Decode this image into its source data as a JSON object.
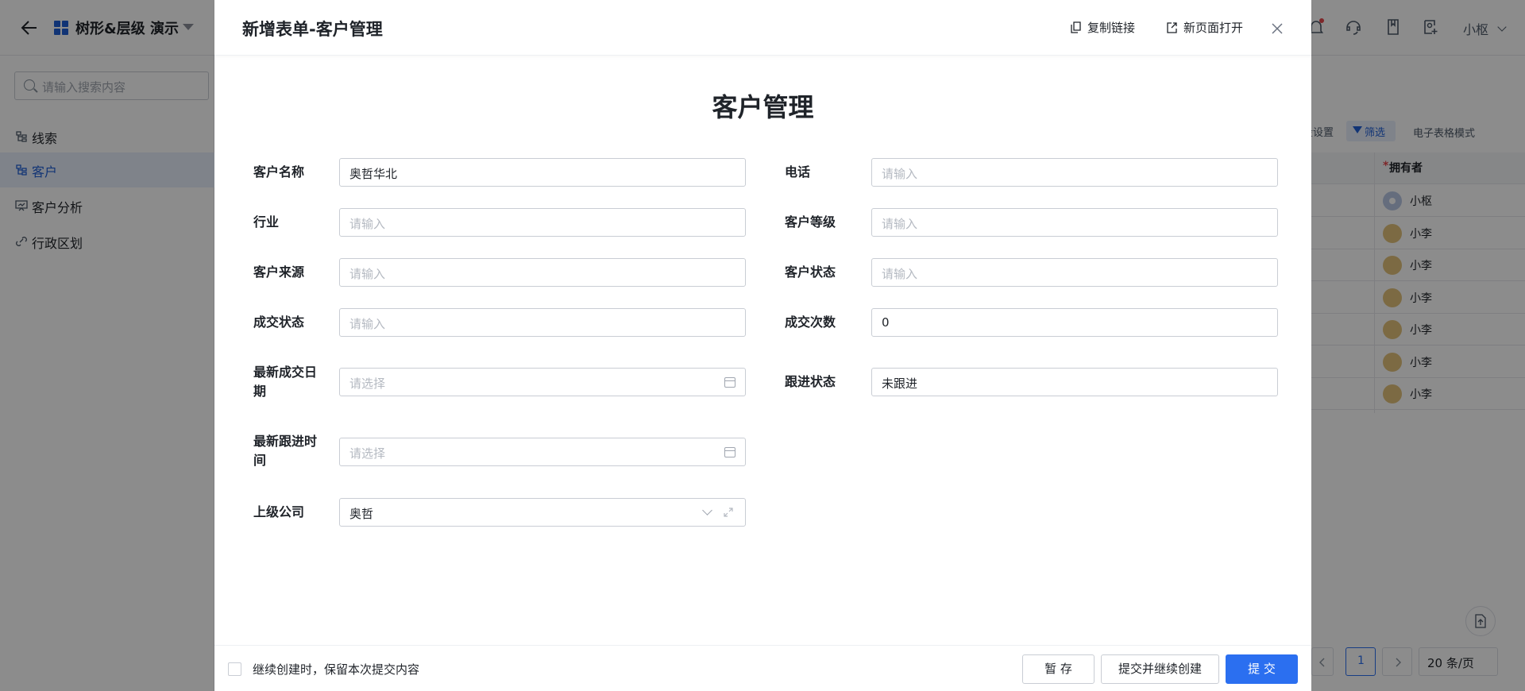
{
  "app": {
    "title": "树形&层级 演示",
    "user_name": "小枢"
  },
  "sidebar": {
    "search_placeholder": "请输入搜索内容",
    "items": [
      {
        "label": "线索"
      },
      {
        "label": "客户"
      },
      {
        "label": "客户分析"
      },
      {
        "label": "行政区划"
      }
    ]
  },
  "background_table": {
    "toolbar": {
      "field_settings": "段设置",
      "filter": "筛选",
      "mode": "电子表格模式"
    },
    "owner_header": "拥有者",
    "rows": [
      "小枢",
      "小李",
      "小李",
      "小李",
      "小李",
      "小李",
      "小李"
    ],
    "pager": {
      "current_page": "1",
      "page_size": "20 条/页"
    }
  },
  "drawer": {
    "title": "新增表单-客户管理",
    "copy_link": "复制链接",
    "open_new_page": "新页面打开"
  },
  "form": {
    "title": "客户管理",
    "fields": {
      "customer_name": {
        "label": "客户名称",
        "value": "奥哲华北"
      },
      "phone": {
        "label": "电话",
        "placeholder": "请输入"
      },
      "industry": {
        "label": "行业",
        "placeholder": "请输入"
      },
      "customer_level": {
        "label": "客户等级",
        "placeholder": "请输入"
      },
      "customer_source": {
        "label": "客户来源",
        "placeholder": "请输入"
      },
      "customer_status": {
        "label": "客户状态",
        "placeholder": "请输入"
      },
      "deal_status": {
        "label": "成交状态",
        "placeholder": "请输入"
      },
      "deal_count": {
        "label": "成交次数",
        "value": "0"
      },
      "latest_deal_date": {
        "label_line1": "最新成交日",
        "label_line2": "期",
        "placeholder": "请选择"
      },
      "follow_status": {
        "label": "跟进状态",
        "value": "未跟进"
      },
      "latest_follow_time": {
        "label_line1": "最新跟进时",
        "label_line2": "间",
        "placeholder": "请选择"
      },
      "parent_company": {
        "label": "上级公司",
        "value": "奥哲"
      }
    }
  },
  "footer": {
    "keep_content_label": "继续创建时，保留本次提交内容",
    "save_draft": "暂 存",
    "submit_continue": "提交并继续创建",
    "submit": "提 交"
  }
}
